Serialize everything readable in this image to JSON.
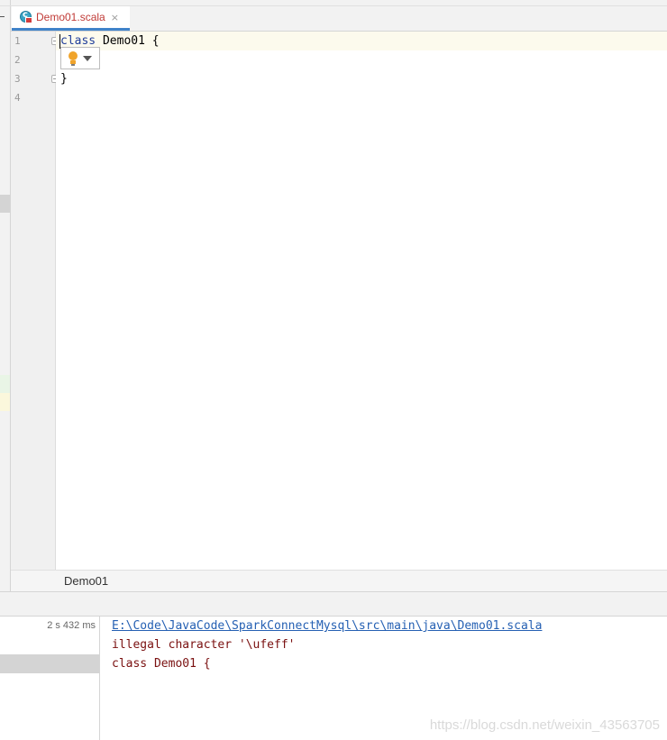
{
  "tab": {
    "filename": "Demo01.scala",
    "close_glyph": "×",
    "accent_color": "#4083c9"
  },
  "editor": {
    "line_numbers": [
      "1",
      "2",
      "3",
      "4"
    ],
    "lines": [
      {
        "keyword": "class",
        "rest": " Demo01 {"
      },
      {
        "keyword": "",
        "rest": ""
      },
      {
        "keyword": "",
        "rest": "}"
      },
      {
        "keyword": "",
        "rest": ""
      }
    ],
    "intention_icon": "lightbulb-icon"
  },
  "breadcrumb": {
    "item": "Demo01"
  },
  "build": {
    "duration": "2 s 432 ms",
    "file_link": "E:\\Code\\JavaCode\\SparkConnectMysql\\src\\main\\java\\Demo01.scala",
    "error_message": "illegal character '\\ufeff'",
    "code_snippet": "class Demo01 {"
  },
  "watermark": "https://blog.csdn.net/weixin_43563705"
}
